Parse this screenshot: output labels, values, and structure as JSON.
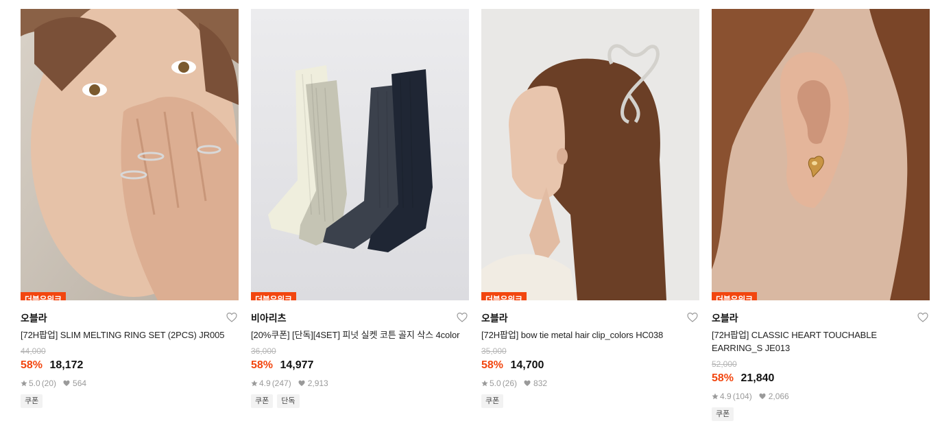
{
  "products": [
    {
      "badge": "더블유위크",
      "brand": "오블라",
      "title": "[72H팝업] SLIM MELTING RING SET (2PCS) JR005",
      "original_price": "44,000",
      "discount": "58%",
      "price": "18,172",
      "rating": "5.0",
      "reviews": "(20)",
      "likes": "564",
      "tags": [
        "쿠폰"
      ],
      "image_icon": "model-ring-photo"
    },
    {
      "badge": "더블유위크",
      "brand": "비아리츠",
      "title": "[20%쿠폰] [단독][4SET] 피넛 실켓 코튼 골지 삭스 4color",
      "original_price": "36,000",
      "discount": "58%",
      "price": "14,977",
      "rating": "4.9",
      "reviews": "(247)",
      "likes": "2,913",
      "tags": [
        "쿠폰",
        "단독"
      ],
      "image_icon": "socks-photo"
    },
    {
      "badge": "더블유위크",
      "brand": "오블라",
      "title": "[72H팝업] bow tie metal hair clip_colors HC038",
      "original_price": "35,000",
      "discount": "58%",
      "price": "14,700",
      "rating": "5.0",
      "reviews": "(26)",
      "likes": "832",
      "tags": [
        "쿠폰"
      ],
      "image_icon": "hair-clip-photo"
    },
    {
      "badge": "더블유위크",
      "brand": "오블라",
      "title": "[72H팝업] CLASSIC HEART TOUCHABLE EARRING_S JE013",
      "original_price": "52,000",
      "discount": "58%",
      "price": "21,840",
      "rating": "4.9",
      "reviews": "(104)",
      "likes": "2,066",
      "tags": [
        "쿠폰"
      ],
      "image_icon": "earring-photo"
    }
  ],
  "colors": {
    "accent": "#f2460f",
    "muted": "#9a9a9a"
  }
}
